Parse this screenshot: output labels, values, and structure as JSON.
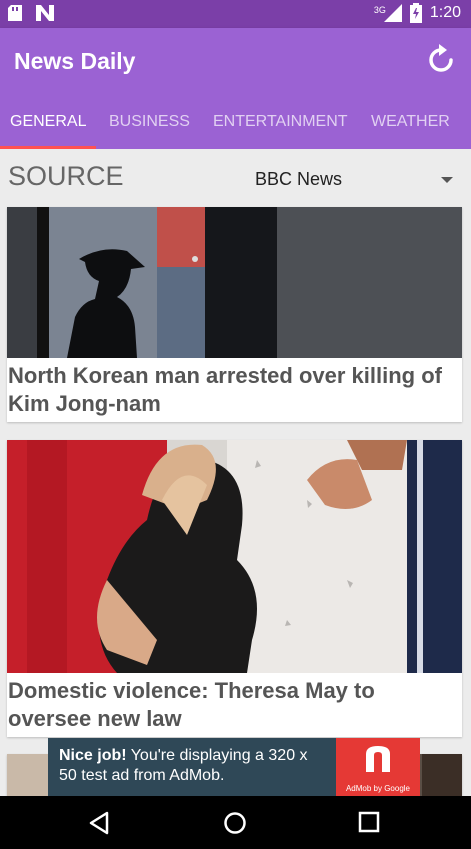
{
  "status_bar": {
    "network": "3G",
    "time": "1:20"
  },
  "app": {
    "title": "News Daily"
  },
  "tabs": [
    {
      "label": "GENERAL",
      "active": true
    },
    {
      "label": "BUSINESS",
      "active": false
    },
    {
      "label": "ENTERTAINMENT",
      "active": false
    },
    {
      "label": "WEATHER",
      "active": false
    }
  ],
  "source": {
    "label": "SOURCE",
    "selected": "BBC News"
  },
  "articles": [
    {
      "headline": "North Korean man arrested over killing of Kim Jong-nam",
      "image": "silhouette-police-officer"
    },
    {
      "headline": "Domestic violence: Theresa May to oversee new law",
      "image": "woman-crouching-fist"
    },
    {
      "headline": "",
      "image": "partial-card"
    }
  ],
  "ad": {
    "bold": "Nice job!",
    "text": " You're displaying a 320 x 50 test ad from AdMob.",
    "brand": "AdMob by Google"
  },
  "colors": {
    "status_bar": "#7b3fa8",
    "app_bar": "#9b62d3",
    "tab_indicator": "#ff5252",
    "ad_background": "#2f4857",
    "ad_badge": "#e53935"
  }
}
